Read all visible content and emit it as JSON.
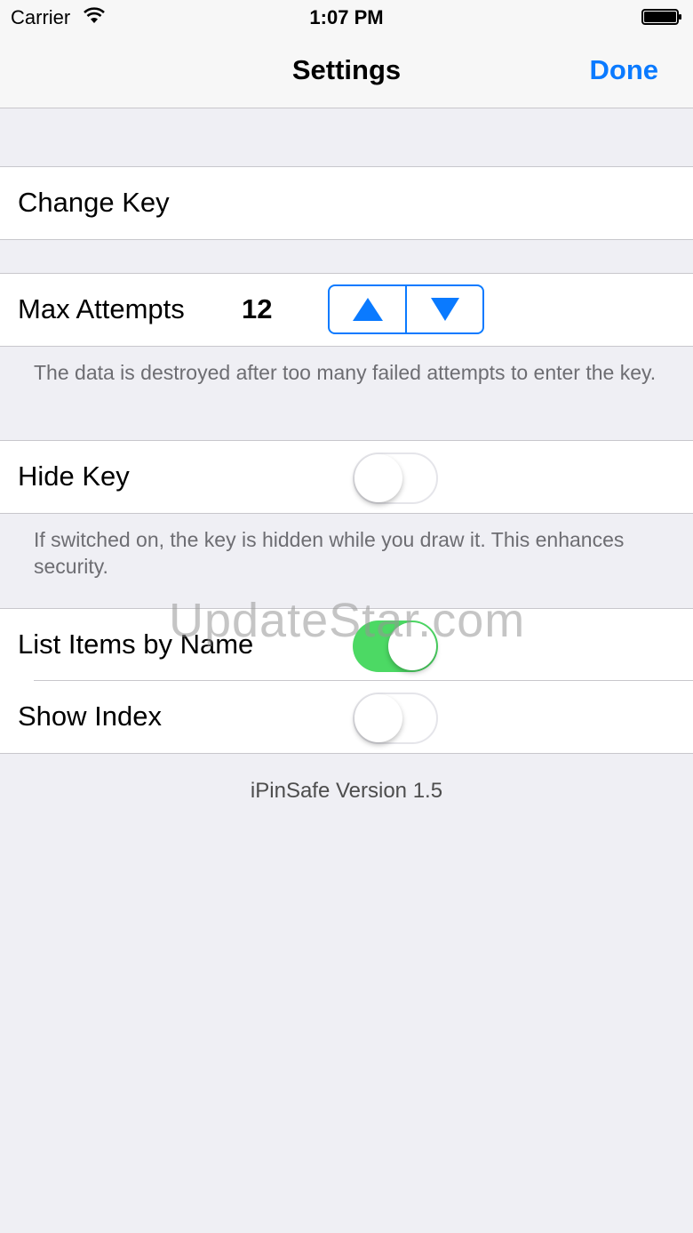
{
  "status_bar": {
    "carrier": "Carrier",
    "time": "1:07 PM",
    "wifi_icon": "wifi-icon",
    "battery_icon": "battery-icon"
  },
  "nav": {
    "title": "Settings",
    "done_label": "Done"
  },
  "change_key": {
    "label": "Change Key"
  },
  "max_attempts": {
    "label": "Max Attempts",
    "value": "12",
    "increment_icon": "triangle-up-icon",
    "decrement_icon": "triangle-down-icon",
    "footer": "The data is destroyed after too many failed attempts to enter the key."
  },
  "hide_key": {
    "label": "Hide Key",
    "on": false,
    "footer": "If switched on, the key is hidden while you draw it. This enhances security."
  },
  "list_items_by_name": {
    "label": "List Items by Name",
    "on": true
  },
  "show_index": {
    "label": "Show Index",
    "on": false
  },
  "version": "iPinSafe Version 1.5",
  "watermark": "UpdateStar.com",
  "colors": {
    "accent": "#0a7aff",
    "toggle_on": "#4cd964",
    "background": "#efeff4",
    "footer_text": "#6d6d72"
  }
}
